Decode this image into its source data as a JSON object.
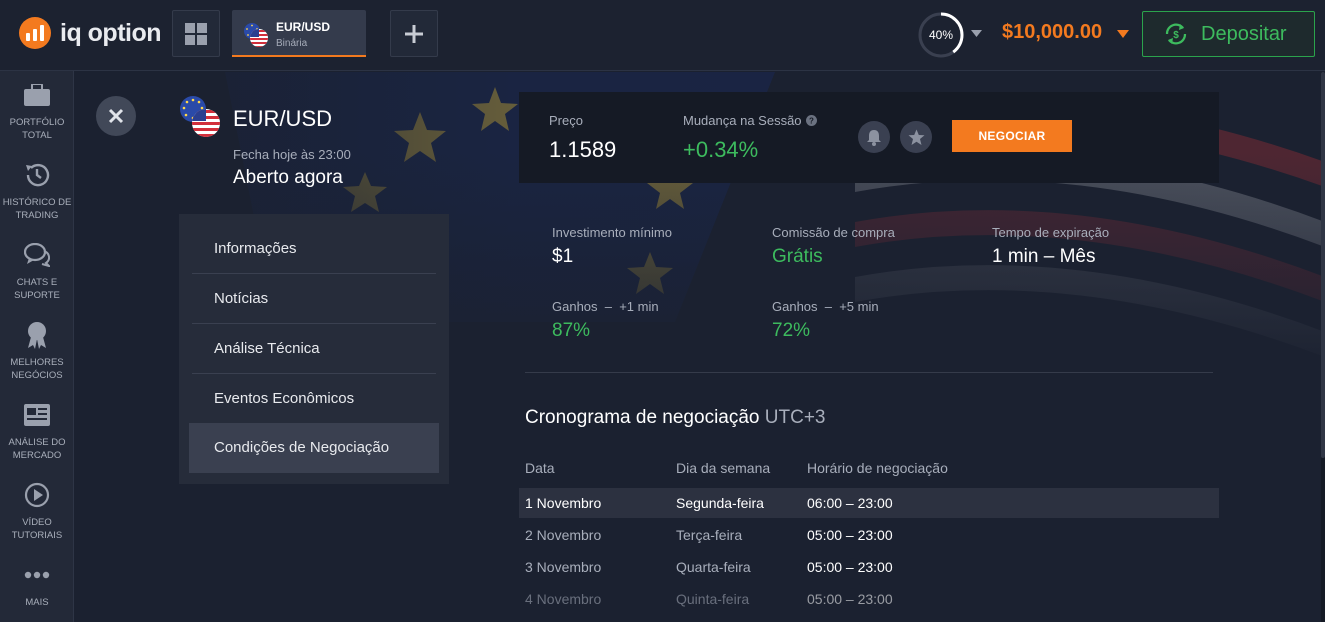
{
  "brand": {
    "name": "iq option",
    "color": "#f37a1f"
  },
  "header": {
    "asset_tab": {
      "name": "EUR/USD",
      "type": "Binária"
    },
    "progress_percent": 40,
    "progress_label": "40%",
    "balance": "$10,000.00",
    "deposit_label": "Depositar",
    "icons": [
      "grid-icon",
      "plus-icon",
      "chevron-down-icon",
      "deposit-icon"
    ]
  },
  "sidebar": {
    "items": [
      {
        "label": "PORTFÓLIO\nTOTAL",
        "icon": "briefcase-icon"
      },
      {
        "label": "HISTÓRICO DE\nTRADING",
        "icon": "history-icon"
      },
      {
        "label": "CHATS E\nSUPORTE",
        "icon": "chat-icon"
      },
      {
        "label": "MELHORES\nNEGÓCIOS",
        "icon": "award-icon"
      },
      {
        "label": "ANÁLISE DO\nMERCADO",
        "icon": "newspaper-icon"
      },
      {
        "label": "VÍDEO\nTUTORIAIS",
        "icon": "play-icon"
      },
      {
        "label": "MAIS",
        "icon": "more-icon"
      }
    ]
  },
  "asset": {
    "name": "EUR/USD",
    "closes_text": "Fecha hoje às 23:00",
    "status": "Aberto agora"
  },
  "menu": {
    "items": [
      {
        "label": "Informações"
      },
      {
        "label": "Notícias"
      },
      {
        "label": "Análise Técnica"
      },
      {
        "label": "Eventos Econômicos"
      },
      {
        "label": "Condições de Negociação",
        "active": true
      }
    ]
  },
  "price_panel": {
    "price_label": "Preço",
    "price": "1.1589",
    "change_label": "Mudança na Sessão",
    "change": "+0.34%",
    "trade_button": "NEGOCIAR",
    "icons": [
      "help-icon",
      "bell-icon",
      "star-icon"
    ]
  },
  "conditions": {
    "min_investment_label": "Investimento mínimo",
    "min_investment": "$1",
    "commission_label": "Comissão de compra",
    "commission": "Grátis",
    "expiry_label": "Tempo de expiração",
    "expiry": "1 min – Mês",
    "gain1_label": "Ganhos  –  +1 min",
    "gain1": "87%",
    "gain5_label": "Ganhos  –  +5 min",
    "gain5": "72%"
  },
  "schedule": {
    "title": "Cronograma de negociação",
    "timezone": "UTC+3",
    "headers": [
      "Data",
      "Dia da semana",
      "Horário de negociação"
    ],
    "rows": [
      [
        "1 Novembro",
        "Segunda-feira",
        "06:00 – 23:00"
      ],
      [
        "2 Novembro",
        "Terça-feira",
        "05:00 – 23:00"
      ],
      [
        "3 Novembro",
        "Quarta-feira",
        "05:00 – 23:00"
      ],
      [
        "4 Novembro",
        "Quinta-feira",
        "05:00 – 23:00"
      ]
    ]
  },
  "colors": {
    "accent": "#f37a1f",
    "positive": "#3dbb5e",
    "background": "#1b2130",
    "panel": "#262c3a"
  }
}
